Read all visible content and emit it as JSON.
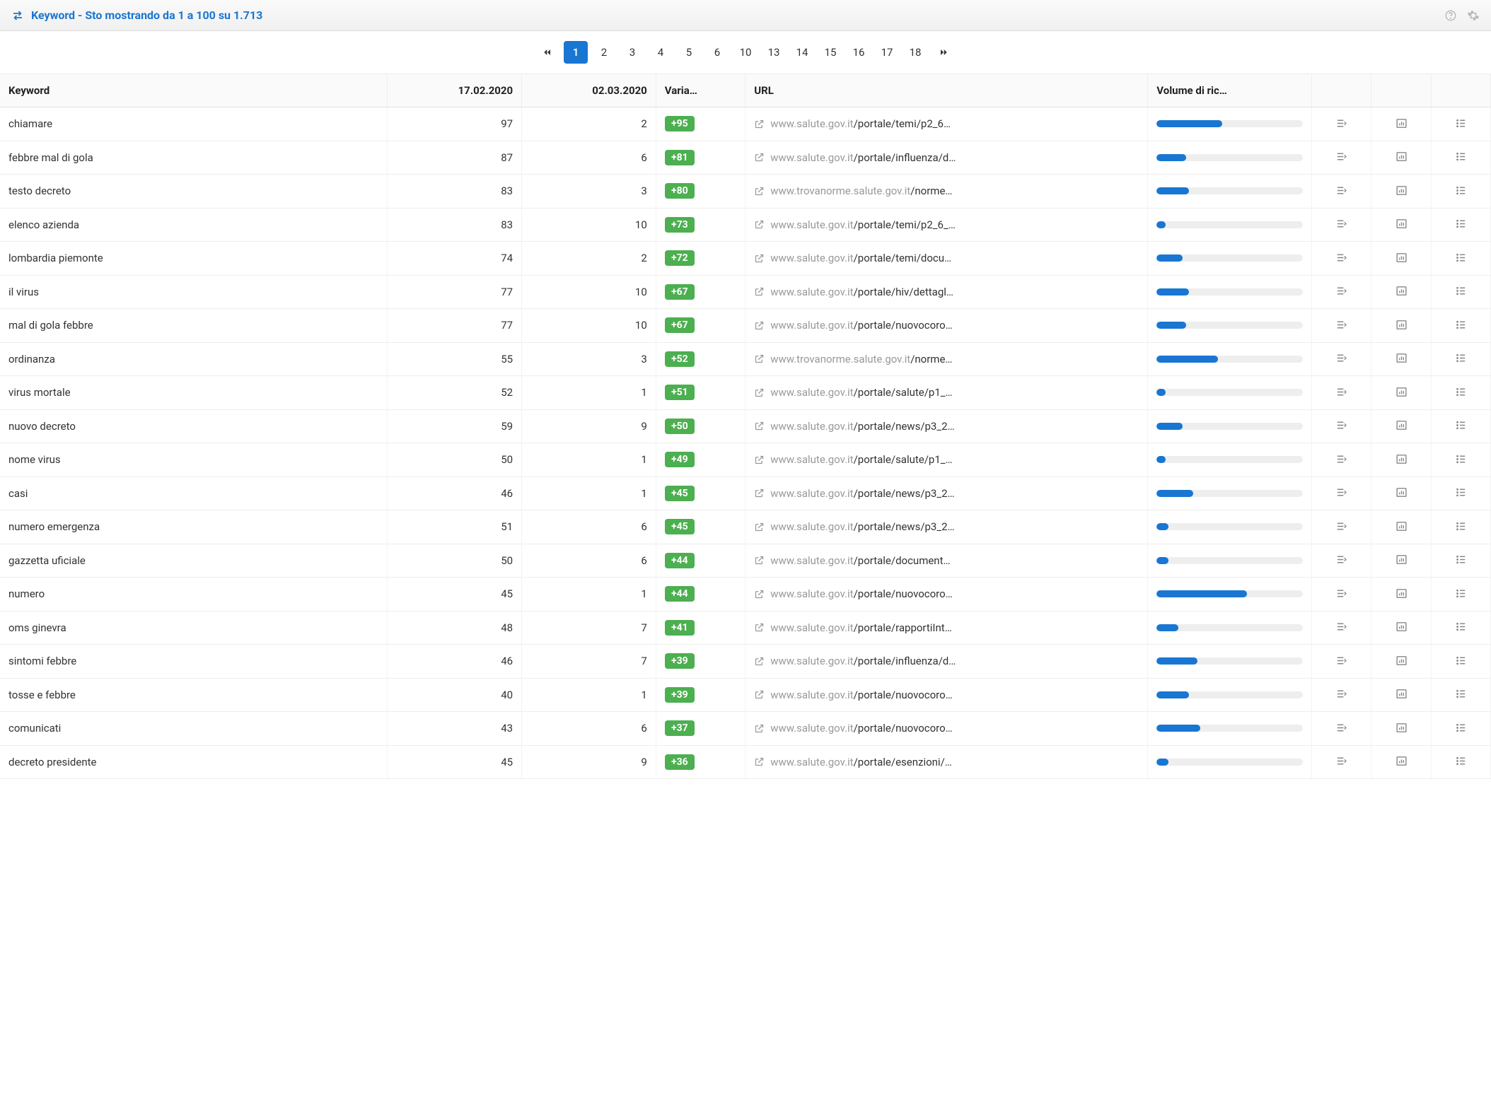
{
  "header": {
    "title": "Keyword - Sto mostrando da 1 a 100 su 1.713"
  },
  "pagination": {
    "pages": [
      "1",
      "2",
      "3",
      "4",
      "5",
      "6",
      "10",
      "13",
      "14",
      "15",
      "16",
      "17",
      "18"
    ],
    "active": "1"
  },
  "columns": {
    "keyword": "Keyword",
    "date1": "17.02.2020",
    "date2": "02.03.2020",
    "varia": "Varia…",
    "url": "URL",
    "volume": "Volume di ric…"
  },
  "rows": [
    {
      "keyword": "chiamare",
      "d1": "97",
      "d2": "2",
      "var": "+95",
      "domain": "www.salute.gov.it",
      "path": "/portale/temi/p2_6…",
      "vol": 45
    },
    {
      "keyword": "febbre mal di gola",
      "d1": "87",
      "d2": "6",
      "var": "+81",
      "domain": "www.salute.gov.it",
      "path": "/portale/influenza/d…",
      "vol": 20
    },
    {
      "keyword": "testo decreto",
      "d1": "83",
      "d2": "3",
      "var": "+80",
      "domain": "www.trovanorme.salute.gov.it",
      "path": "/norme…",
      "vol": 22
    },
    {
      "keyword": "elenco azienda",
      "d1": "83",
      "d2": "10",
      "var": "+73",
      "domain": "www.salute.gov.it",
      "path": "/portale/temi/p2_6_…",
      "vol": 6
    },
    {
      "keyword": "lombardia piemonte",
      "d1": "74",
      "d2": "2",
      "var": "+72",
      "domain": "www.salute.gov.it",
      "path": "/portale/temi/docu…",
      "vol": 18
    },
    {
      "keyword": "il virus",
      "d1": "77",
      "d2": "10",
      "var": "+67",
      "domain": "www.salute.gov.it",
      "path": "/portale/hiv/dettagl…",
      "vol": 22
    },
    {
      "keyword": "mal di gola febbre",
      "d1": "77",
      "d2": "10",
      "var": "+67",
      "domain": "www.salute.gov.it",
      "path": "/portale/nuovocoro…",
      "vol": 20
    },
    {
      "keyword": "ordinanza",
      "d1": "55",
      "d2": "3",
      "var": "+52",
      "domain": "www.trovanorme.salute.gov.it",
      "path": "/norme…",
      "vol": 42
    },
    {
      "keyword": "virus mortale",
      "d1": "52",
      "d2": "1",
      "var": "+51",
      "domain": "www.salute.gov.it",
      "path": "/portale/salute/p1_…",
      "vol": 6
    },
    {
      "keyword": "nuovo decreto",
      "d1": "59",
      "d2": "9",
      "var": "+50",
      "domain": "www.salute.gov.it",
      "path": "/portale/news/p3_2…",
      "vol": 18
    },
    {
      "keyword": "nome virus",
      "d1": "50",
      "d2": "1",
      "var": "+49",
      "domain": "www.salute.gov.it",
      "path": "/portale/salute/p1_…",
      "vol": 6
    },
    {
      "keyword": "casi",
      "d1": "46",
      "d2": "1",
      "var": "+45",
      "domain": "www.salute.gov.it",
      "path": "/portale/news/p3_2…",
      "vol": 25
    },
    {
      "keyword": "numero emergenza",
      "d1": "51",
      "d2": "6",
      "var": "+45",
      "domain": "www.salute.gov.it",
      "path": "/portale/news/p3_2…",
      "vol": 8
    },
    {
      "keyword": "gazzetta uficiale",
      "d1": "50",
      "d2": "6",
      "var": "+44",
      "domain": "www.salute.gov.it",
      "path": "/portale/document…",
      "vol": 8
    },
    {
      "keyword": "numero",
      "d1": "45",
      "d2": "1",
      "var": "+44",
      "domain": "www.salute.gov.it",
      "path": "/portale/nuovocoro…",
      "vol": 62
    },
    {
      "keyword": "oms ginevra",
      "d1": "48",
      "d2": "7",
      "var": "+41",
      "domain": "www.salute.gov.it",
      "path": "/portale/rapportiInt…",
      "vol": 15
    },
    {
      "keyword": "sintomi febbre",
      "d1": "46",
      "d2": "7",
      "var": "+39",
      "domain": "www.salute.gov.it",
      "path": "/portale/influenza/d…",
      "vol": 28
    },
    {
      "keyword": "tosse e febbre",
      "d1": "40",
      "d2": "1",
      "var": "+39",
      "domain": "www.salute.gov.it",
      "path": "/portale/nuovocoro…",
      "vol": 22
    },
    {
      "keyword": "comunicati",
      "d1": "43",
      "d2": "6",
      "var": "+37",
      "domain": "www.salute.gov.it",
      "path": "/portale/nuovocoro…",
      "vol": 30
    },
    {
      "keyword": "decreto presidente",
      "d1": "45",
      "d2": "9",
      "var": "+36",
      "domain": "www.salute.gov.it",
      "path": "/portale/esenzioni/…",
      "vol": 8
    }
  ]
}
